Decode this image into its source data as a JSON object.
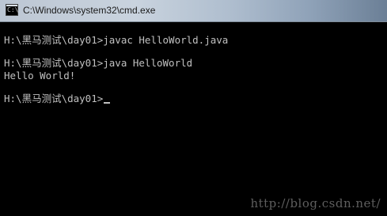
{
  "window": {
    "title": "C:\\Windows\\system32\\cmd.exe",
    "icon": "cmd-app-icon",
    "icon_text": "C:\\"
  },
  "console": {
    "lines": [
      "H:\\黑马测试\\day01>javac HelloWorld.java",
      "",
      "H:\\黑马测试\\day01>java HelloWorld",
      "Hello World!",
      "",
      "H:\\黑马测试\\day01>"
    ]
  },
  "watermark": "http://blog.csdn.net/"
}
